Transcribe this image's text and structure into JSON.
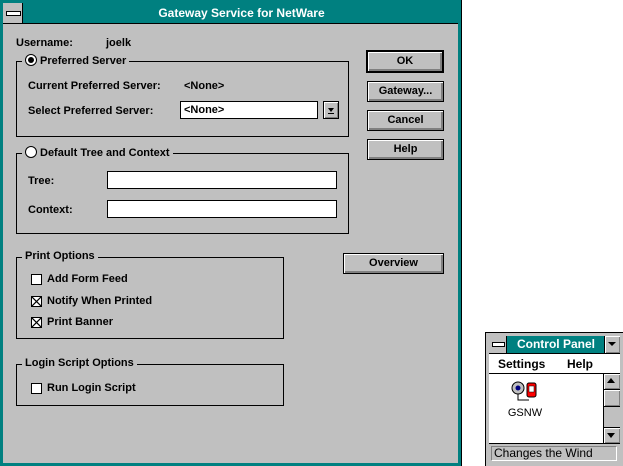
{
  "dialog": {
    "title": "Gateway Service for NetWare",
    "username_label": "Username:",
    "username_value": "joelk",
    "preferred_server": {
      "legend": "Preferred Server",
      "selected": true,
      "current_label": "Current Preferred Server:",
      "current_value": "<None>",
      "select_label": "Select Preferred Server:",
      "select_value": "<None>"
    },
    "default_tree": {
      "legend": "Default Tree and Context",
      "selected": false,
      "tree_label": "Tree:",
      "tree_value": "",
      "context_label": "Context:",
      "context_value": ""
    },
    "print_options": {
      "legend": "Print Options",
      "add_form_feed": {
        "label": "Add Form Feed",
        "checked": false
      },
      "notify_when_printed": {
        "label": "Notify When Printed",
        "checked": true
      },
      "print_banner": {
        "label": "Print Banner",
        "checked": true
      }
    },
    "login_script_options": {
      "legend": "Login Script Options",
      "run_login_script": {
        "label": "Run Login Script",
        "checked": false
      }
    },
    "buttons": {
      "ok": "OK",
      "gateway": "Gateway...",
      "cancel": "Cancel",
      "help": "Help",
      "overview": "Overview"
    }
  },
  "control_panel": {
    "title": "Control Panel",
    "menu": [
      "Settings",
      "Help"
    ],
    "icons": [
      {
        "label": "GSNW",
        "icon": "gsnw-icon"
      }
    ],
    "status": "Changes the Wind"
  },
  "colors": {
    "title_bar": "#008080",
    "face": "#c0c0c0",
    "window": "#ffffff"
  }
}
